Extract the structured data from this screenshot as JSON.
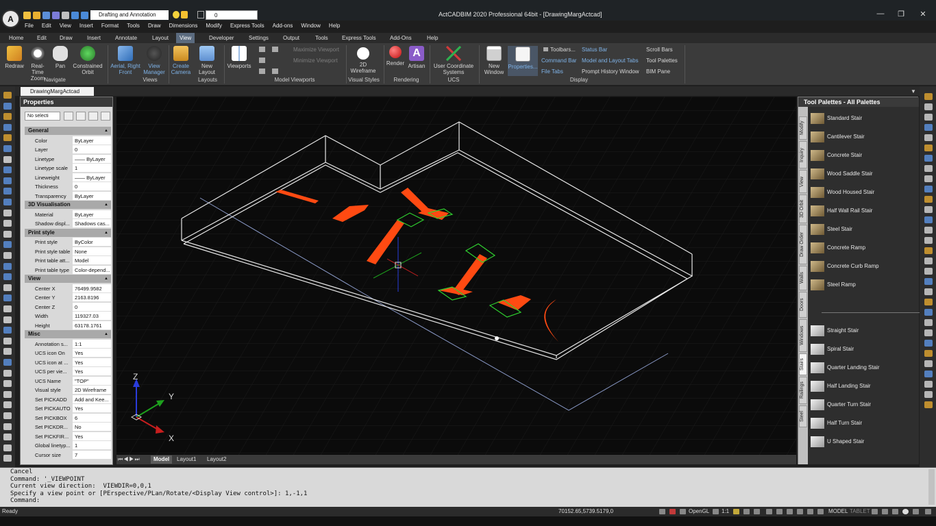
{
  "app": {
    "title": "ActCADBIM 2020 Professional 64bit - [DrawingMargActcad]",
    "logo_letter": "A",
    "workspace": "Drafting and Annotation",
    "layer_value": "0"
  },
  "menu": [
    "File",
    "Edit",
    "View",
    "Insert",
    "Format",
    "Tools",
    "Draw",
    "Dimensions",
    "Modify",
    "Express Tools",
    "Add-ons",
    "Window",
    "Help"
  ],
  "ribbon_tabs": [
    "Home",
    "Edit",
    "Draw",
    "Insert",
    "Annotate",
    "Layout",
    "View",
    "Developer",
    "Settings",
    "Output",
    "Tools",
    "Express Tools",
    "Add-Ons",
    "Help"
  ],
  "ribbon_active_tab": "View",
  "ribbon": {
    "redraw": "Redraw",
    "realtime_zoom": "Real-Time Zoom",
    "pan": "Pan",
    "constrained_orbit": "Constrained Orbit",
    "navigate_group": "Navigate",
    "aerial_front": "Aerial, Right Front",
    "view_manager": "View Manager",
    "views_group": "Views",
    "create_camera": "Create Camera",
    "new_layout": "New Layout",
    "layouts_group": "Layouts",
    "viewports": "Viewports",
    "maximize_viewport": "Maximize Viewport",
    "minimize_viewport": "Minimize Viewport",
    "model_viewports_group": "Model Viewports",
    "wireframe_2d": "2D Wireframe",
    "visual_styles_group": "Visual Styles",
    "render": "Render",
    "artisan": "Artisan",
    "rendering_group": "Rendering",
    "ucs_systems": "User Coordinate Systems",
    "ucs_group": "UCS",
    "new_window": "New Window",
    "properties": "Properties...",
    "toolbars": "Toolbars...",
    "command_bar": "Command Bar",
    "file_tabs": "File Tabs",
    "status_bar": "Status Bar",
    "model_layout_tabs": "Model and Layout Tabs",
    "prompt_history": "Prompt History Window",
    "scroll_bars": "Scroll Bars",
    "tool_palettes": "Tool Palettes",
    "bim_pane": "BIM Pane",
    "display_group": "Display"
  },
  "doc_tab": "DrawingMargActcad",
  "properties": {
    "title": "Properties",
    "selection": "No selecti",
    "categories": [
      {
        "name": "General",
        "rows": [
          [
            "Color",
            "ByLayer"
          ],
          [
            "Layer",
            "0"
          ],
          [
            "Linetype",
            "—— ByLayer"
          ],
          [
            "Linetype scale",
            "1"
          ],
          [
            "Lineweight",
            "—— ByLayer"
          ],
          [
            "Thickness",
            "0"
          ],
          [
            "Transparency",
            "ByLayer"
          ]
        ]
      },
      {
        "name": "3D Visualisation",
        "rows": [
          [
            "Material",
            "ByLayer"
          ],
          [
            "Shadow displ...",
            "Shadows cas..."
          ]
        ]
      },
      {
        "name": "Print style",
        "rows": [
          [
            "Print style",
            "ByColor"
          ],
          [
            "Print style table",
            "None"
          ],
          [
            "Print table att...",
            "Model"
          ],
          [
            "Print table type",
            "Color-depend..."
          ]
        ]
      },
      {
        "name": "View",
        "rows": [
          [
            "Center X",
            "76499.9582"
          ],
          [
            "Center Y",
            "2163.8196"
          ],
          [
            "Center Z",
            "0"
          ],
          [
            "Width",
            "119327.03"
          ],
          [
            "Height",
            "63178.1761"
          ]
        ]
      },
      {
        "name": "Misc",
        "rows": [
          [
            "Annotation s...",
            "1:1"
          ],
          [
            "UCS icon On",
            "Yes"
          ],
          [
            "UCS icon at ...",
            "Yes"
          ],
          [
            "UCS per vie...",
            "Yes"
          ],
          [
            "UCS Name",
            "\"TOP\""
          ],
          [
            "Visual style",
            "2D Wireframe"
          ],
          [
            "Set PICKADD",
            "Add and Kee..."
          ],
          [
            "Set PICKAUTO",
            "Yes"
          ],
          [
            "Set PICKBOX",
            "6"
          ],
          [
            "Set PICKDR...",
            "No"
          ],
          [
            "Set PICKFIR...",
            "Yes"
          ],
          [
            "Global linetyp...",
            "1"
          ],
          [
            "Cursor size",
            "7"
          ]
        ]
      }
    ]
  },
  "viewport": {
    "axis_x": "X",
    "axis_y": "Y",
    "axis_z": "Z"
  },
  "layout_tabs": [
    "Model",
    "Layout1",
    "Layout2"
  ],
  "tool_palette": {
    "title": "Tool Palettes - All Palettes",
    "side_tabs": [
      "Modify",
      "Inquiry",
      "View",
      "3D Orbit",
      "Draw Order",
      "Walls",
      "Doors",
      "Windows",
      "Stairs",
      "Railings",
      "Steel"
    ],
    "active_side_tab": "Stairs",
    "group1": [
      "Standard Stair",
      "Cantilever Stair",
      "Concrete Stair",
      "Wood Saddle Stair",
      "Wood Housed Stair",
      "Half Wall Rail Stair",
      "Steel Stair",
      "Concrete Ramp",
      "Concrete Curb Ramp",
      "Steel Ramp"
    ],
    "group2": [
      "Straight Stair",
      "Spiral Stair",
      "Quarter Landing Stair",
      "Half Landing Stair",
      "Quarter Turn Stair",
      "Half Turn Stair",
      "U Shaped Stair"
    ]
  },
  "command_history": "Cancel\nCommand: '_VIEWPOINT\nCurrent view direction:  VIEWDIR=0,0,1\nSpecify a view point or [PErspective/PLan/Rotate/<Display View control>]: 1,-1,1\nCommand:",
  "status": {
    "ready": "Ready",
    "coords": "70152.65,5739.5179,0",
    "opengl": "OpenGL",
    "scale": "1:1",
    "model": "MODEL",
    "tablet": "TABLET"
  },
  "colors": {
    "stair_orange": "#ff4a12",
    "landing_green": "#2fcf2f",
    "wall_white": "#e8e8e8",
    "ribbon_bg": "#3b3b3b",
    "active_tab": "#5b6b7f"
  }
}
